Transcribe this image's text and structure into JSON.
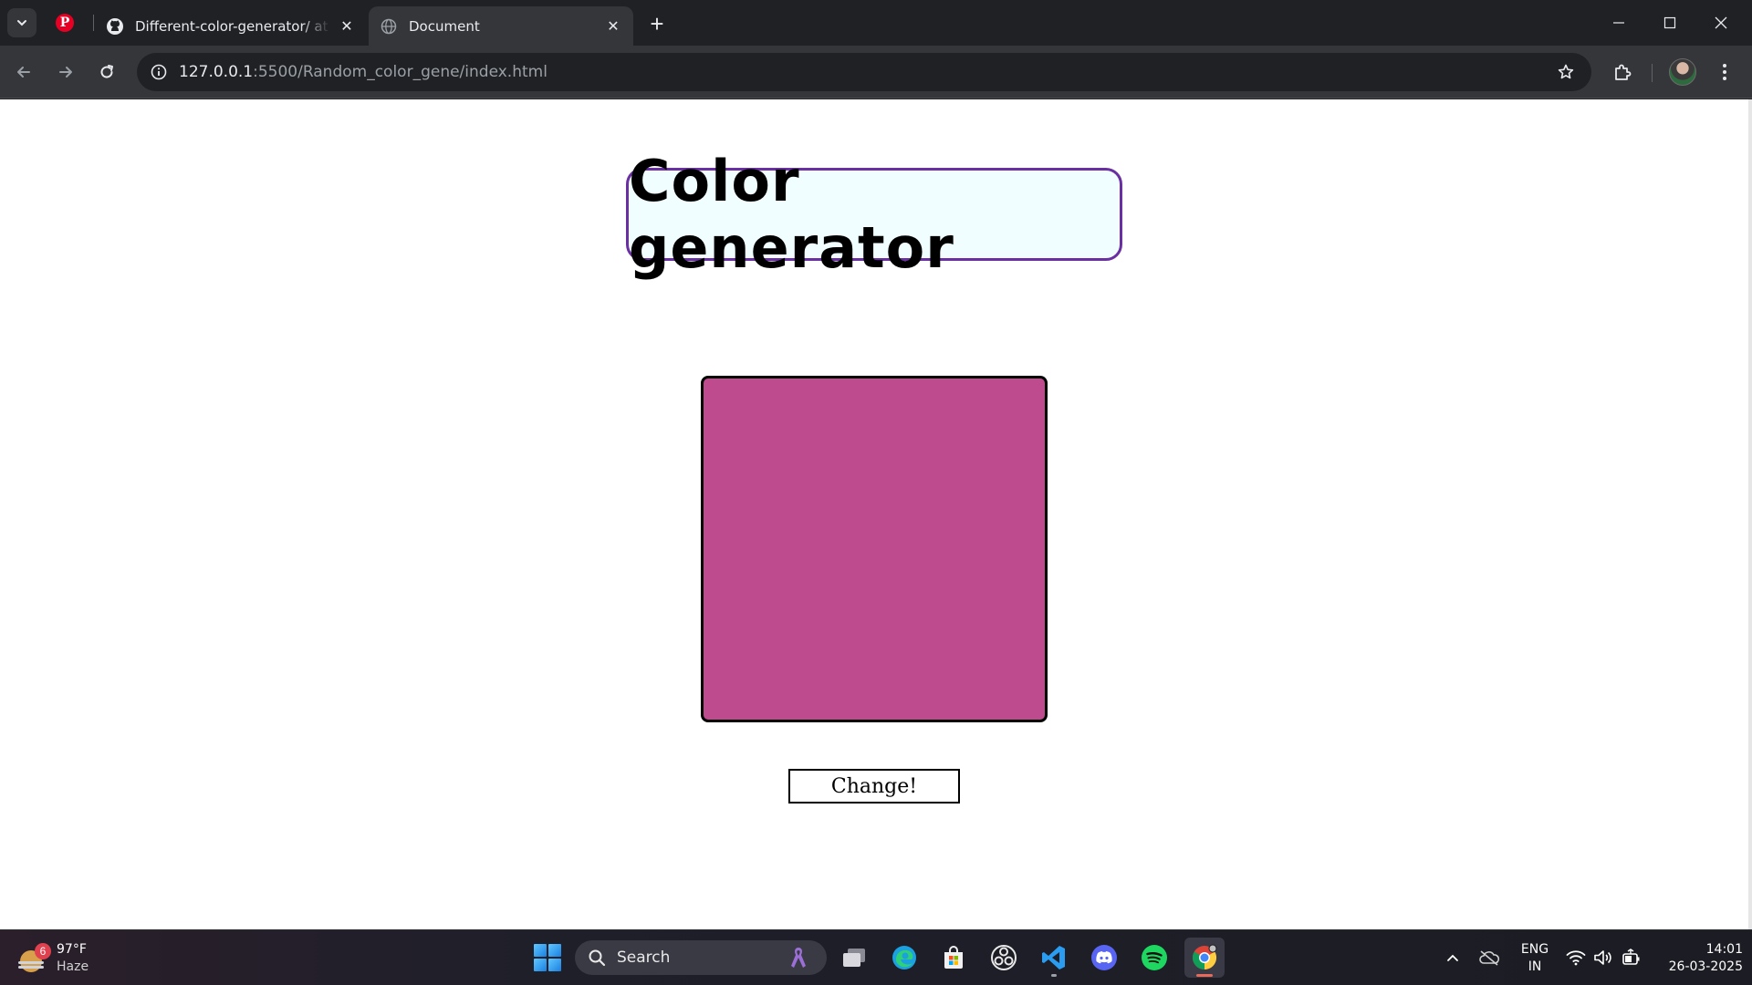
{
  "browser": {
    "tabs": [
      {
        "title": "Different-color-generator/ at m",
        "favicon": "github-icon",
        "active": false
      },
      {
        "title": "Document",
        "favicon": "globe-icon",
        "active": true
      }
    ],
    "pinned_tab_icon": "pinterest-icon",
    "url_host": "127.0.0.1",
    "url_rest": ":5500/Random_color_gene/index.html"
  },
  "page": {
    "heading": "Color generator",
    "box_color": "#bf4b8f",
    "button_label": "Change!"
  },
  "taskbar": {
    "weather": {
      "badge": "6",
      "temperature": "97°F",
      "condition": "Haze"
    },
    "search_placeholder": "Search",
    "language": {
      "line1": "ENG",
      "line2": "IN"
    },
    "time": "14:01",
    "date": "26-03-2025"
  },
  "colors": {
    "heading_border": "#6a2fa0",
    "heading_bg": "#f0feff",
    "box_color": "#bf4b8f",
    "chrome_dark": "#202124",
    "chrome_toolbar": "#35363a"
  }
}
